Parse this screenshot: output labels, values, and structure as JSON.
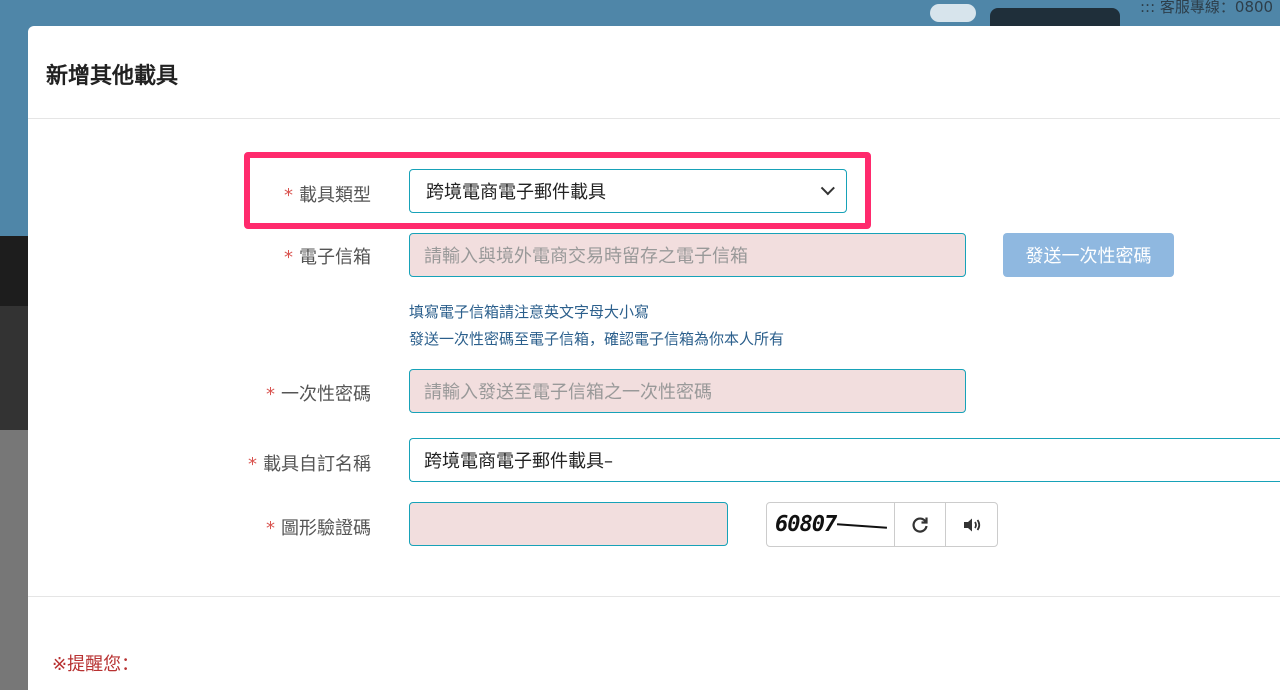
{
  "background": {
    "service_text": "::: 客服專線：0800"
  },
  "modal": {
    "title": "新增其他載具"
  },
  "form": {
    "required_mark": "*",
    "carrier_type": {
      "label": "載具類型",
      "selected": "跨境電商電子郵件載具"
    },
    "email": {
      "label": "電子信箱",
      "placeholder": "請輸入與境外電商交易時留存之電子信箱",
      "send_otp_button": "發送一次性密碼",
      "hint_line1": "填寫電子信箱請注意英文字母大小寫",
      "hint_line2": "發送一次性密碼至電子信箱，確認電子信箱為你本人所有"
    },
    "otp": {
      "label": "一次性密碼",
      "placeholder": "請輸入發送至電子信箱之一次性密碼"
    },
    "nickname": {
      "label": "載具自訂名稱",
      "value": "跨境電商電子郵件載具–"
    },
    "captcha": {
      "label": "圖形驗證碼",
      "value": "",
      "image_text": "60807",
      "refresh_icon": "refresh-icon",
      "audio_icon": "speaker-icon"
    }
  },
  "reminder": {
    "text": "※提醒您："
  },
  "colors": {
    "highlight": "#ff2a6d",
    "input_border": "#17a2b8",
    "input_error_bg": "#f2dede",
    "button": "#8fb8e0",
    "hint": "#2b5f8c",
    "reminder": "#b83232"
  }
}
